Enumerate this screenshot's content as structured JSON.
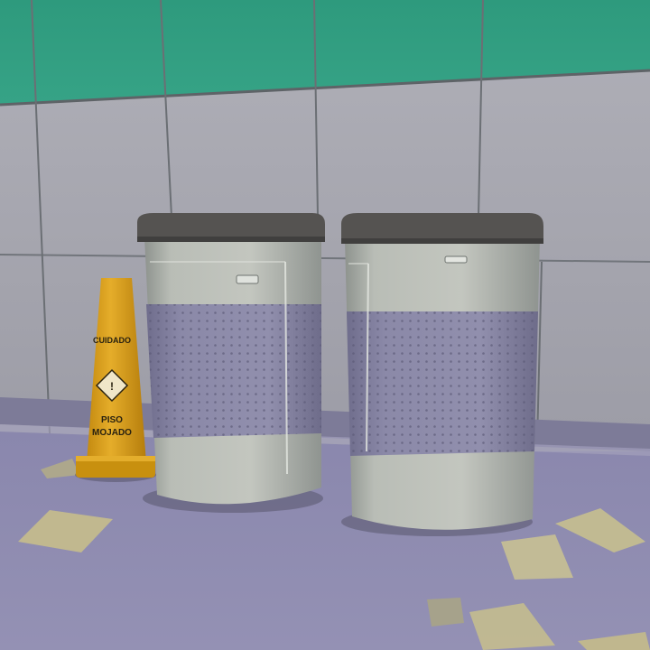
{
  "scene": {
    "description_type": "game-screenshot",
    "colors": {
      "wall_tile_green": "#2f9a7e",
      "wall_tile_grey": "#a9a9b0",
      "grout": "#5f6468",
      "floor": "#8f8cb0",
      "bin_body": "#b3b7b0",
      "bin_band": "#8a88a6",
      "bin_lid": "#545250",
      "cone": "#d9a21c",
      "paper": "#c9c08e"
    }
  },
  "cone": {
    "sign_top_text": "CUIDADO",
    "sign_bottom_line1": "PISO",
    "sign_bottom_line2": "MOJADO",
    "hazard_symbol": "warning-diamond-icon"
  }
}
